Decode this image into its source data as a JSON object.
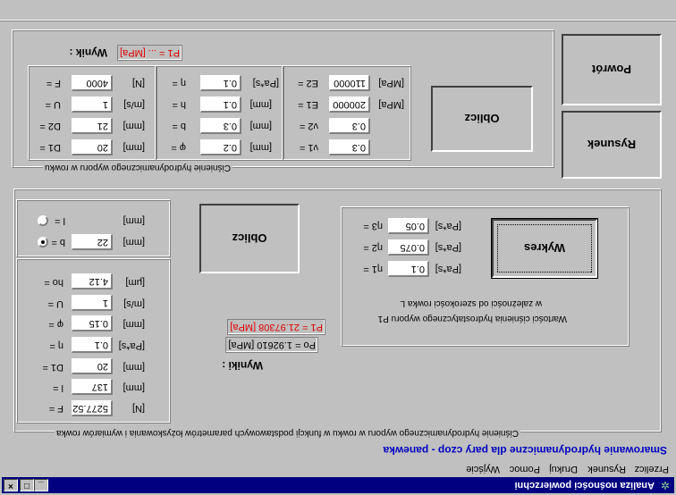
{
  "window": {
    "title": "Analiza nośności powierzchni",
    "controls": {
      "minimize": "_",
      "maximize": "□",
      "close": "×"
    }
  },
  "menu": [
    "Przelicz",
    "Rysunek",
    "Drukuj",
    "Pomoc",
    "Wyjście"
  ],
  "status_text": "Smarowanie hydrodynamiczne dla pary czop - panewka",
  "group1": {
    "caption": "Ciśnienie hydrodynamicznego wyporu w rowku",
    "result_label": "Wynik :",
    "result_value": "P1 = ... [MPa]",
    "col1": [
      {
        "label": "F =",
        "value": "4000",
        "unit": "[N]"
      },
      {
        "label": "U =",
        "value": "1",
        "unit": "[m/s]"
      },
      {
        "label": "D2 =",
        "value": "21",
        "unit": "[mm]"
      },
      {
        "label": "D1 =",
        "value": "20",
        "unit": "[mm]"
      }
    ],
    "col2": [
      {
        "label": "η =",
        "value": "0.1",
        "unit": "[Pa*s]"
      },
      {
        "label": "h =",
        "value": "0.1",
        "unit": "[mm]"
      },
      {
        "label": "b =",
        "value": "0.3",
        "unit": "[mm]"
      },
      {
        "label": "φ =",
        "value": "0.2",
        "unit": "[mm]"
      }
    ],
    "col3": [
      {
        "label": "E2 =",
        "value": "110000",
        "unit": "[MPa]"
      },
      {
        "label": "E1 =",
        "value": "200000",
        "unit": "[MPa]"
      },
      {
        "label": "ν2 =",
        "value": "0.3",
        "unit": ""
      },
      {
        "label": "ν1 =",
        "value": "0.3",
        "unit": ""
      }
    ],
    "button": "Oblicz"
  },
  "right_buttons": {
    "back": "Powrót",
    "drawing": "Rysunek"
  },
  "group2": {
    "caption": "Ciśnienie hydrodynamicznego wyporu w rowku w funkcji podstawowych parametrów łożyskowania i wymiarów rowka",
    "radio_l": {
      "label": "l =",
      "unit": "[mm]"
    },
    "radio_b": {
      "label": "b =",
      "value": "22",
      "unit": "[mm]"
    },
    "params": [
      {
        "label": "ho =",
        "value": "4.12",
        "unit": "[μm]"
      },
      {
        "label": "U =",
        "value": "1",
        "unit": "[m/s]"
      },
      {
        "label": "φ =",
        "value": "0.15",
        "unit": "[mm]"
      },
      {
        "label": "η =",
        "value": "0.1",
        "unit": "[Pa*s]"
      },
      {
        "label": "D1 =",
        "value": "20",
        "unit": "[mm]"
      },
      {
        "label": "l =",
        "value": "137",
        "unit": "[mm]"
      },
      {
        "label": "F =",
        "value": "5277.52",
        "unit": "[N]"
      }
    ],
    "button": "Oblicz",
    "results_label": "Wyniki :",
    "result_p1": "P1 = 21.97308 [MPa]",
    "result_po": "Po = 1.92610 [MPa]",
    "chart_box": {
      "text1": "Wartości ciśnienia hydrostatycznego wyporu P1",
      "text2": "w zależności od szerokości rowka L",
      "etas": [
        {
          "label": "η3 =",
          "value": "0.05",
          "unit": "[Pa*s]"
        },
        {
          "label": "η2 =",
          "value": "0.075",
          "unit": "[Pa*s]"
        },
        {
          "label": "η1 =",
          "value": "0.1",
          "unit": "[Pa*s]"
        }
      ],
      "button": "Wykres"
    }
  }
}
